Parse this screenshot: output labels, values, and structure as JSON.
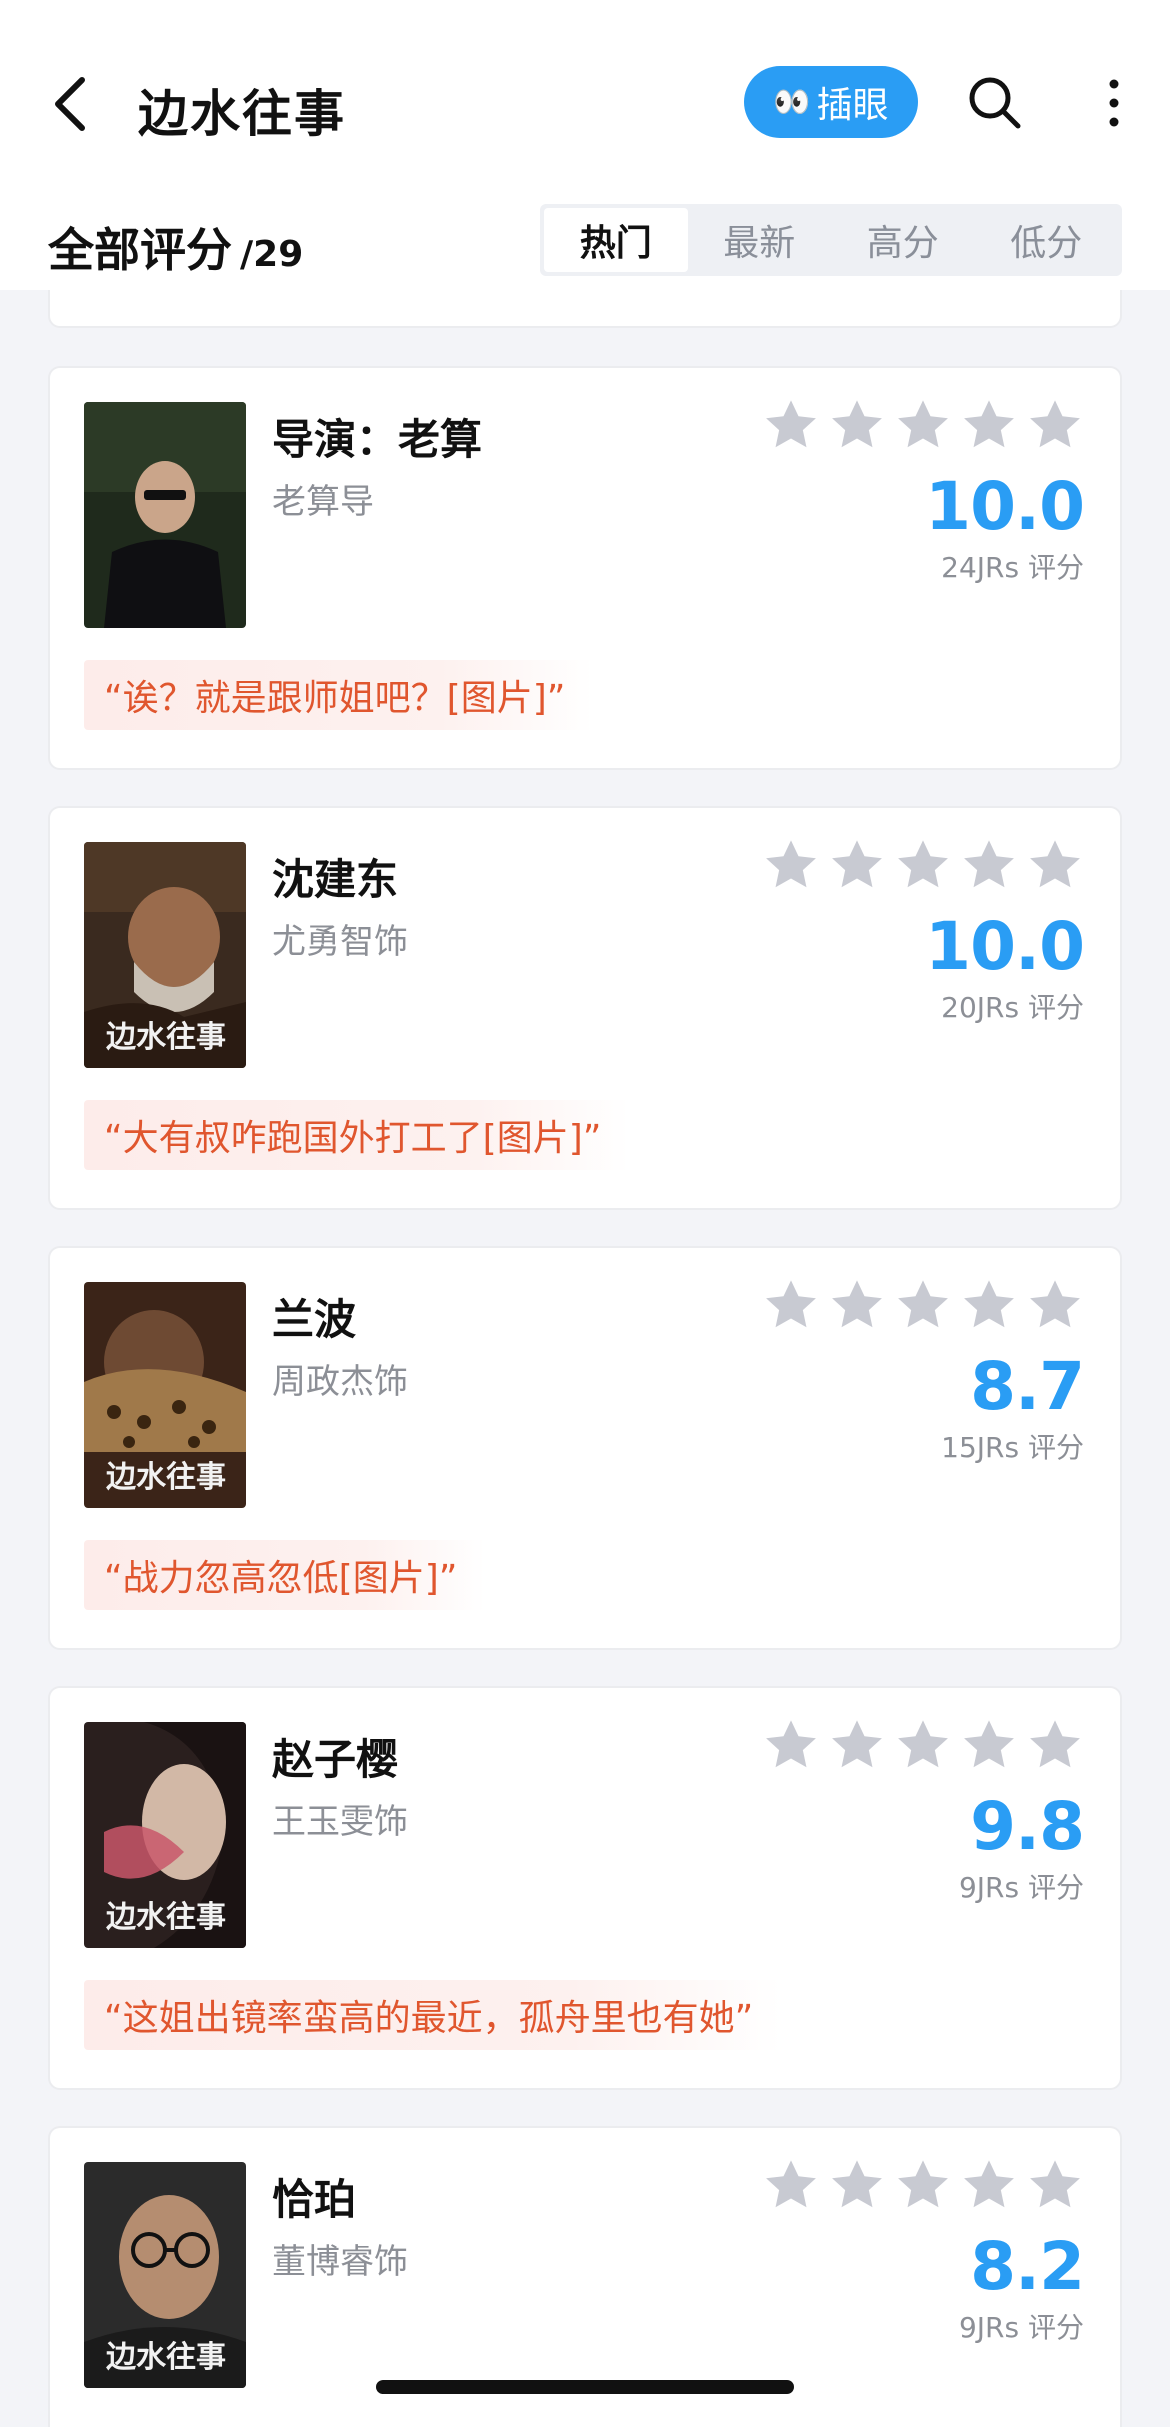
{
  "header": {
    "title": "边水往事",
    "peek_label": "插眼",
    "peek_emoji": "👀"
  },
  "subheader": {
    "all_label": "全部评分",
    "count": "/29",
    "tabs": [
      {
        "label": "热门",
        "active": true
      },
      {
        "label": "最新",
        "active": false
      },
      {
        "label": "高分",
        "active": false
      },
      {
        "label": "低分",
        "active": false
      }
    ]
  },
  "colors": {
    "accent": "#2a9df4",
    "quote_text": "#e0562e",
    "star": "#c8cad2"
  },
  "cards": [
    {
      "name": "导演：老算",
      "actor": "老算导",
      "score": "10.0",
      "count": "24JRs 评分",
      "quote": "“诶？就是跟师姐吧？[图片]”",
      "stars": 5
    },
    {
      "name": "沈建东",
      "actor": "尤勇智饰",
      "score": "10.0",
      "count": "20JRs 评分",
      "quote": "“大有叔咋跑国外打工了[图片]”",
      "stars": 5
    },
    {
      "name": "兰波",
      "actor": " 周政杰饰",
      "score": "8.7",
      "count": "15JRs 评分",
      "quote": "“战力忽高忽低[图片]”",
      "stars": 5
    },
    {
      "name": "赵子樱",
      "actor": "王玉雯饰",
      "score": "9.8",
      "count": "9JRs 评分",
      "quote": "“这姐出镜率蛮高的最近，孤舟里也有她”",
      "stars": 5
    },
    {
      "name": "恰珀",
      "actor": "董博睿饰",
      "score": "8.2",
      "count": "9JRs 评分",
      "quote": "",
      "stars": 5
    }
  ]
}
